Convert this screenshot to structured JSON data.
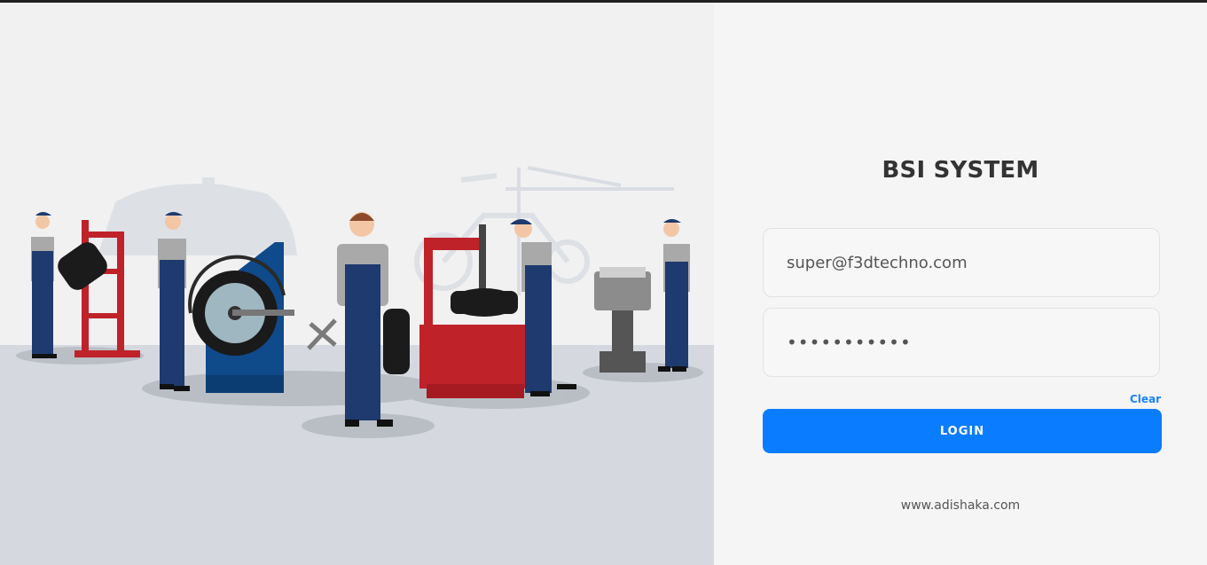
{
  "app_title": "BSI SYSTEM",
  "login": {
    "email_value": "super@f3dtechno.com",
    "password_value": "password123",
    "clear_label": "Clear",
    "login_label": "LOGIN"
  },
  "footer": {
    "website": "www.adishaka.com"
  },
  "colors": {
    "accent": "#0a7cff",
    "link": "#1a84f5",
    "worker_uniform": "#1e3a6e",
    "machine_red": "#c0222a"
  }
}
